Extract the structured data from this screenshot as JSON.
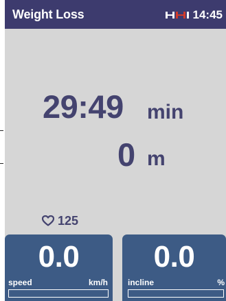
{
  "header": {
    "title": "Weight Loss",
    "time": "14:45",
    "status_icon": "treadmill-connection-icon"
  },
  "workout": {
    "elapsed_value": "29:49",
    "elapsed_unit": "min",
    "distance_value": "0",
    "distance_unit": "m"
  },
  "heart_rate": {
    "icon": "heart-icon",
    "value": "125"
  },
  "tiles": {
    "speed": {
      "value": "0.0",
      "label": "speed",
      "unit": "km/h",
      "level": 0
    },
    "incline": {
      "value": "0.0",
      "label": "incline",
      "unit": "%",
      "level": 0
    }
  },
  "colors": {
    "header_bg": "#3d3b6e",
    "panel_bg": "#d6d6d6",
    "text_main": "#44436f",
    "tile_bg": "#3d5b85",
    "icon_accent": "#d23a2a"
  }
}
